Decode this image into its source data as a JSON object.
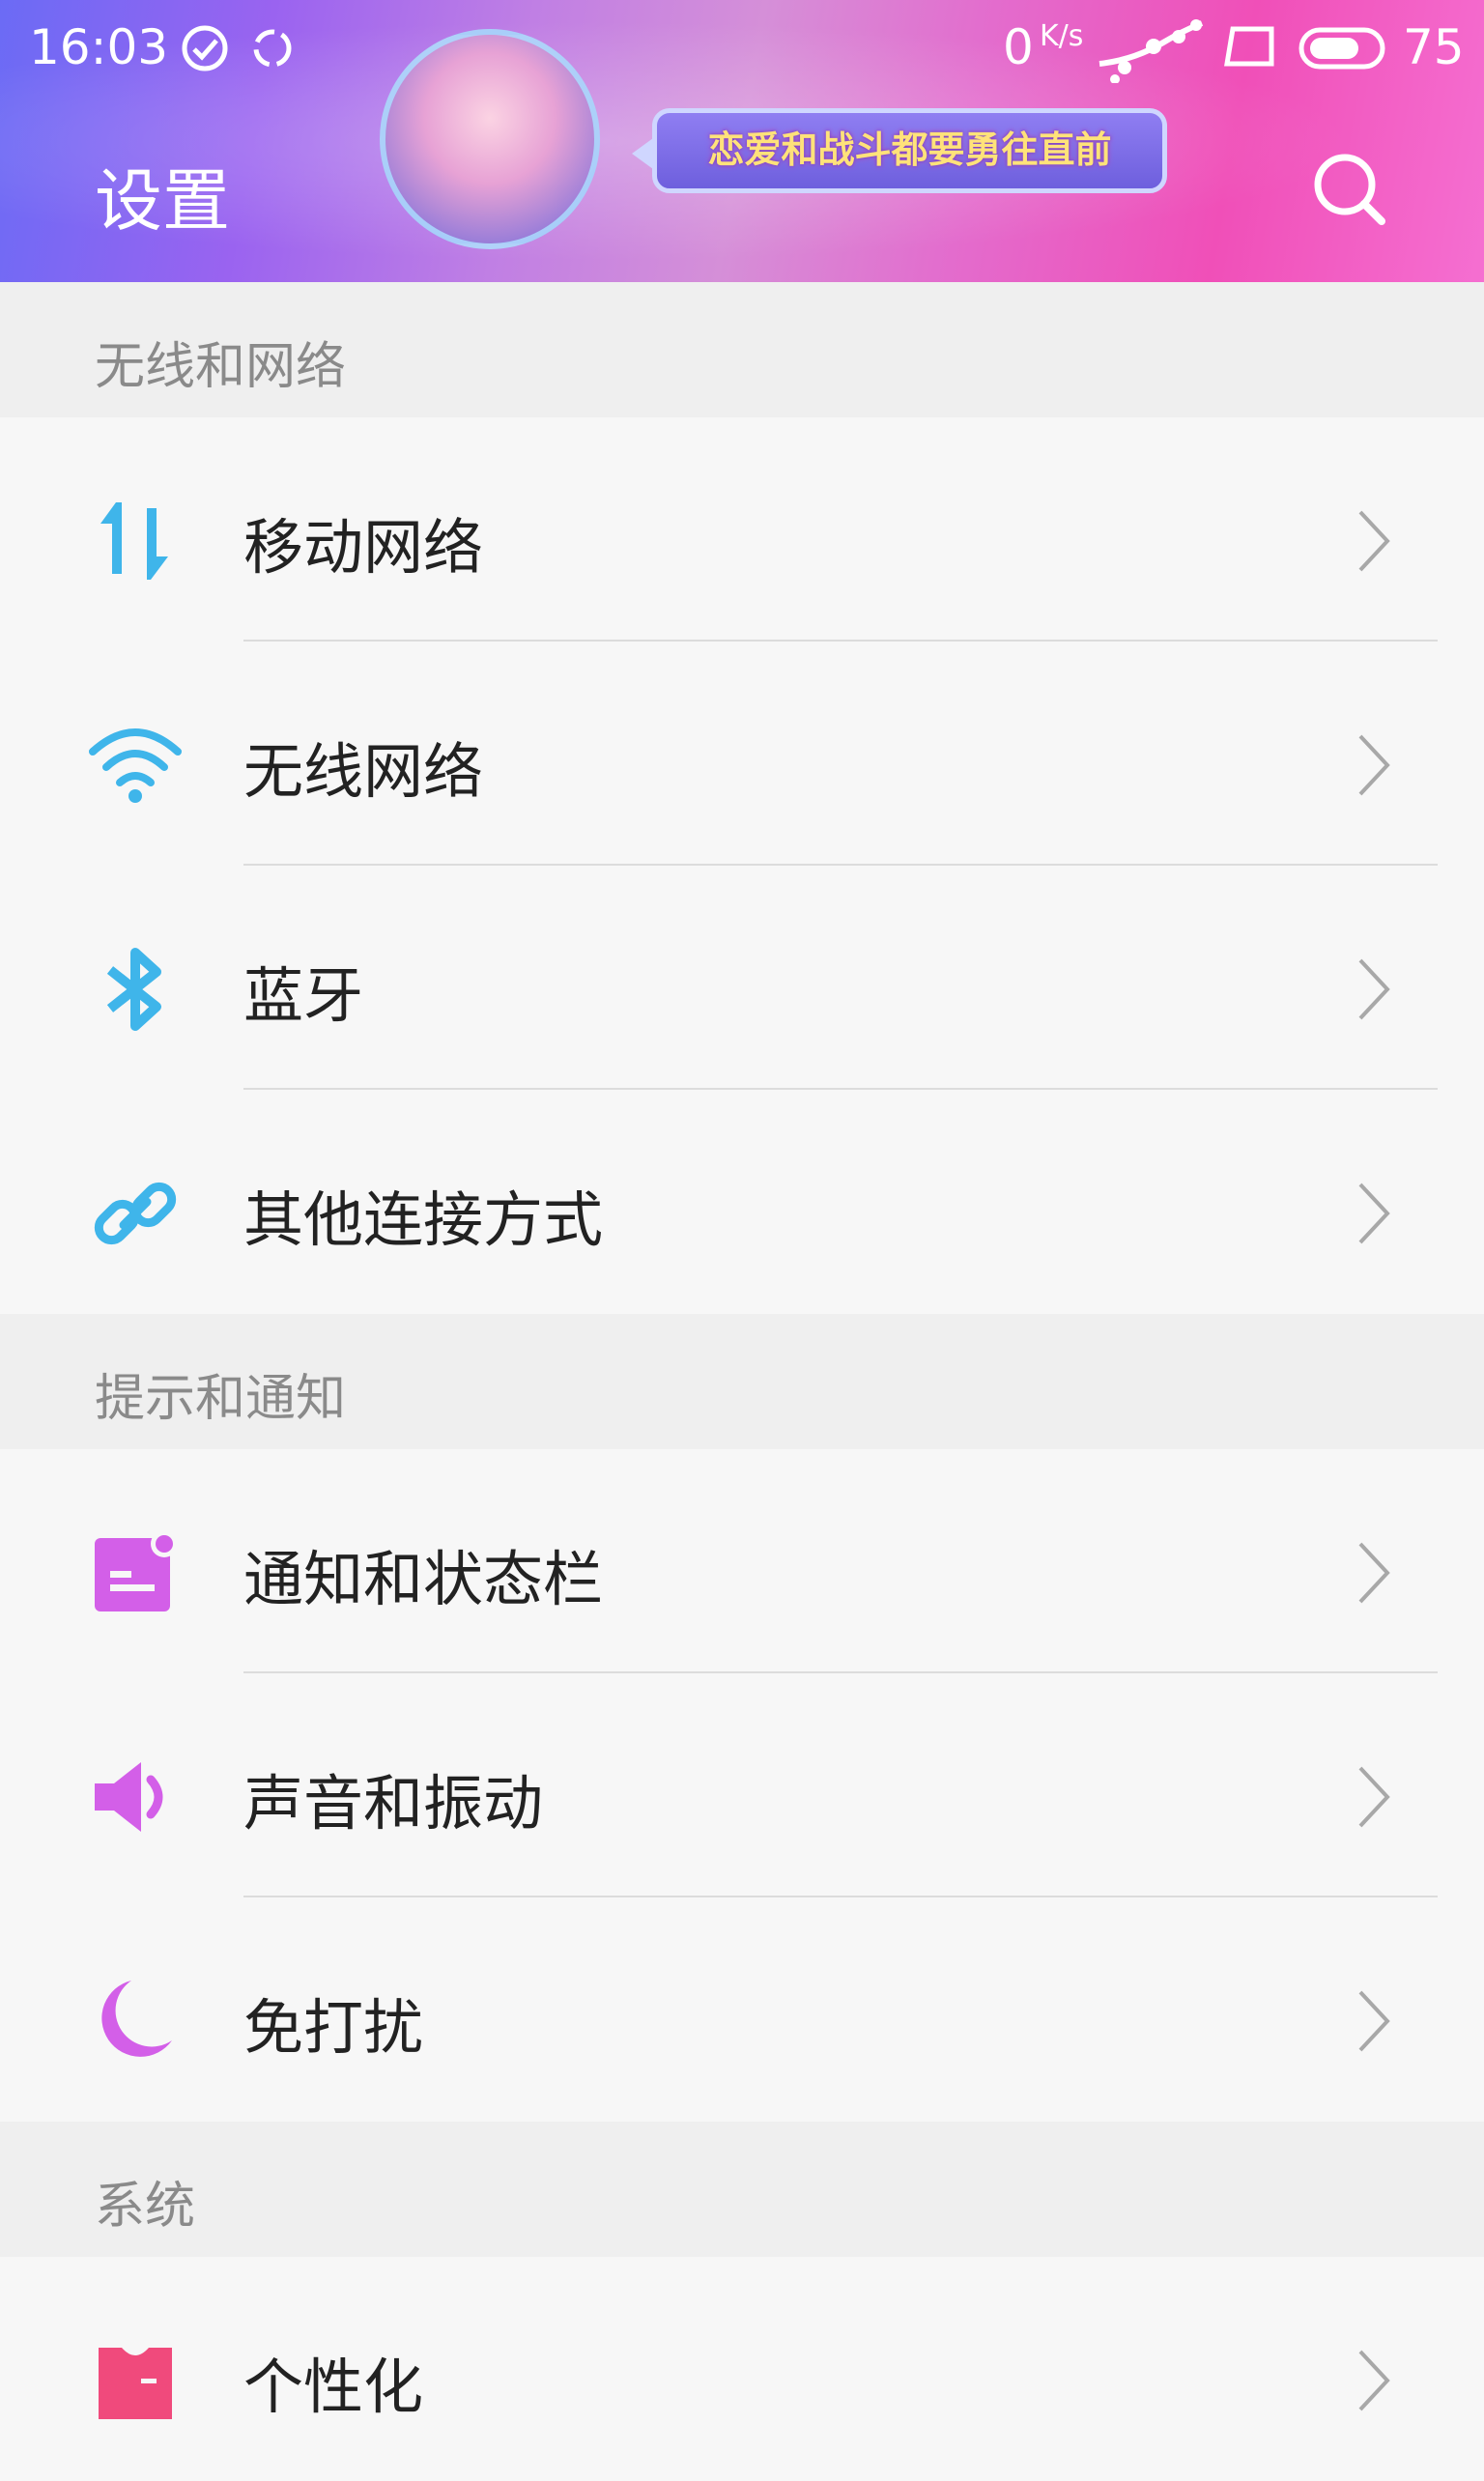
{
  "status_bar": {
    "time": "16:03",
    "net_speed": "0",
    "net_unit": "K/s",
    "battery": "75"
  },
  "header": {
    "title": "设置",
    "banner_text": "恋爱和战斗都要勇往直前"
  },
  "sections": {
    "wireless": {
      "title": "无线和网络",
      "items": [
        {
          "label": "移动网络",
          "icon": "mobile-data-icon"
        },
        {
          "label": "无线网络",
          "icon": "wifi-icon"
        },
        {
          "label": "蓝牙",
          "icon": "bluetooth-icon"
        },
        {
          "label": "其他连接方式",
          "icon": "link-icon"
        }
      ]
    },
    "notify": {
      "title": "提示和通知",
      "items": [
        {
          "label": "通知和状态栏",
          "icon": "notification-icon"
        },
        {
          "label": "声音和振动",
          "icon": "speaker-icon"
        },
        {
          "label": "免打扰",
          "icon": "moon-icon"
        }
      ]
    },
    "system": {
      "title": "系统",
      "items": [
        {
          "label": "个性化",
          "icon": "theme-shirt-icon"
        }
      ]
    }
  },
  "colors": {
    "wireless_icon": "#3fb5ea",
    "notify_icon": "#d35fe8",
    "system_icon": "#f04a7c"
  }
}
